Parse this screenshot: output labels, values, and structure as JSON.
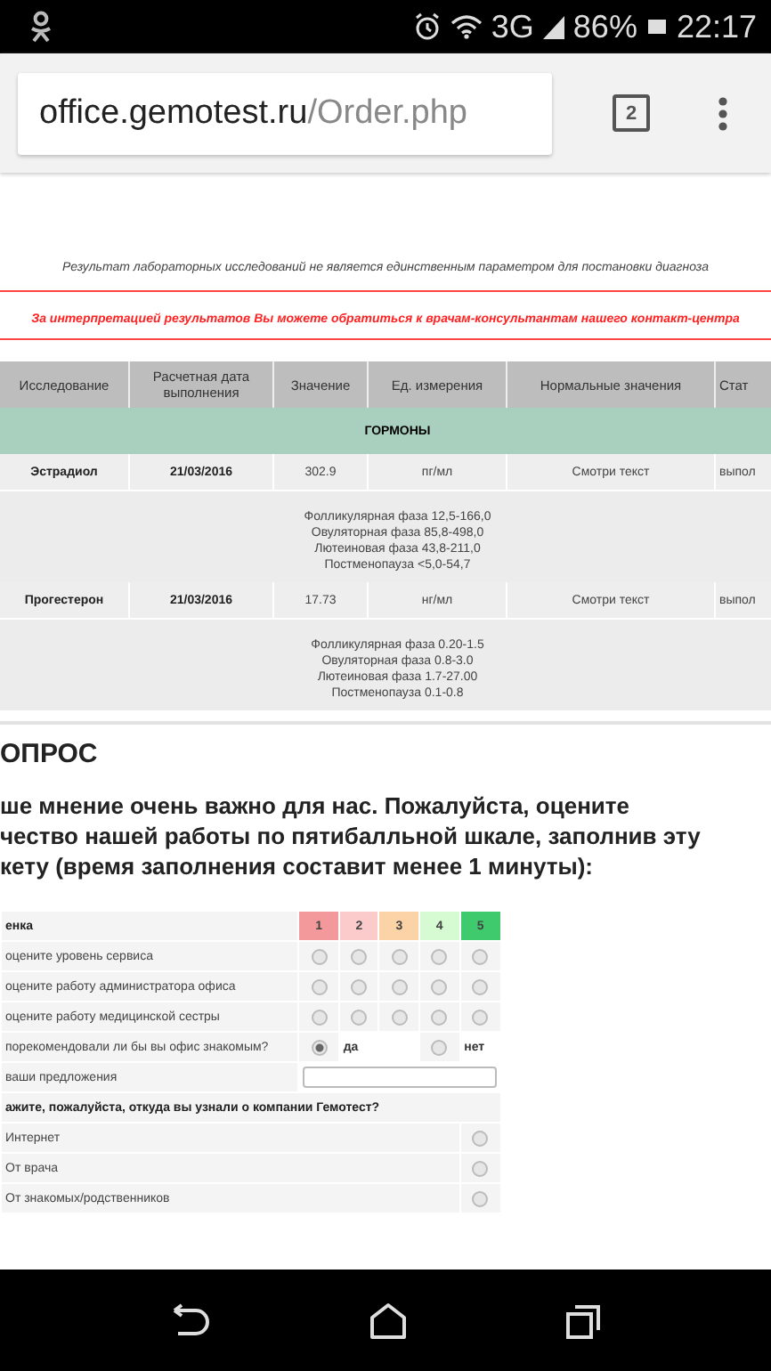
{
  "status_bar": {
    "network": "3G",
    "battery": "86%",
    "time": "22:17"
  },
  "browser": {
    "url_host": "office.gemotest.ru",
    "url_path": "/Order.php",
    "tab_count": "2"
  },
  "notices": [
    {
      "kind": "plain",
      "text": "Результат лабораторных исследований не является единственным параметром для постановки диагноза"
    },
    {
      "kind": "warning",
      "text": "За интерпретацией результатов Вы можете обратиться к врачам-консультантам нашего контакт-центра"
    }
  ],
  "results_table": {
    "columns": [
      "Исследование",
      "Расчетная дата выполнения",
      "Значение",
      "Ед. измерения",
      "Нормальные значения",
      "Стат"
    ],
    "groups": [
      {
        "name": "ГОРМОНЫ",
        "rows": [
          {
            "cells": [
              "Эстрадиол",
              "21/03/2016",
              "302.9",
              "пг/мл",
              "Смотри текст",
              "выпол"
            ],
            "reference": [
              "Фолликулярная фаза 12,5-166,0",
              "Овуляторная фаза 85,8-498,0",
              "Лютеиновая фаза 43,8-211,0",
              "Постменопауза <5,0-54,7"
            ]
          },
          {
            "cells": [
              "Прогестерон",
              "21/03/2016",
              "17.73",
              "нг/мл",
              "Смотри текст",
              "выпол"
            ],
            "reference": [
              "Фолликулярная фаза 0.20-1.5",
              "Овуляторная фаза 0.8-3.0",
              "Лютеиновая фаза 1.7-27.00",
              "Постменопауза 0.1-0.8"
            ]
          }
        ]
      }
    ]
  },
  "survey": {
    "title": "ОПРОС",
    "intro": [
      "ше мнение очень важно для нас. Пожалуйста, оцените",
      "чество нашей работы по пятибалльной шкале, заполнив эту",
      "кету (время заполнения составит менее 1 минуты):"
    ],
    "rating_header": {
      "label": "енка",
      "scale": [
        {
          "label": "1",
          "color": "#f4999b"
        },
        {
          "label": "2",
          "color": "#fbcaca"
        },
        {
          "label": "3",
          "color": "#fbd3a6"
        },
        {
          "label": "4",
          "color": "#d6fbd3"
        },
        {
          "label": "5",
          "color": "#3fcb6d"
        }
      ]
    },
    "questions": [
      {
        "kind": "rating",
        "label": "оцените уровень сервиса",
        "options": [
          {
            "selected": false
          },
          {
            "selected": false
          },
          {
            "selected": false
          },
          {
            "selected": false
          },
          {
            "selected": false
          }
        ]
      },
      {
        "kind": "rating",
        "label": "оцените работу администратора офиса",
        "options": [
          {
            "selected": false
          },
          {
            "selected": false
          },
          {
            "selected": false
          },
          {
            "selected": false
          },
          {
            "selected": false
          }
        ]
      },
      {
        "kind": "rating",
        "label": "оцените работу медицинской сестры",
        "options": [
          {
            "selected": false
          },
          {
            "selected": false
          },
          {
            "selected": false
          },
          {
            "selected": false
          },
          {
            "selected": false
          }
        ]
      },
      {
        "kind": "yesno",
        "label": "порекомендовали ли бы вы офис знакомым?",
        "options": [
          {
            "label": "да",
            "selected": true
          },
          {
            "label": "нет",
            "selected": false
          }
        ]
      },
      {
        "kind": "text",
        "label": "ваши предложения"
      }
    ],
    "source_question": {
      "heading": "ажите, пожалуйста, откуда вы узнали о компании Гемотест?",
      "options": [
        {
          "label": "Интернет",
          "selected": false
        },
        {
          "label": "От врача",
          "selected": false
        },
        {
          "label": "От знакомых/родственников",
          "selected": false
        }
      ]
    }
  }
}
